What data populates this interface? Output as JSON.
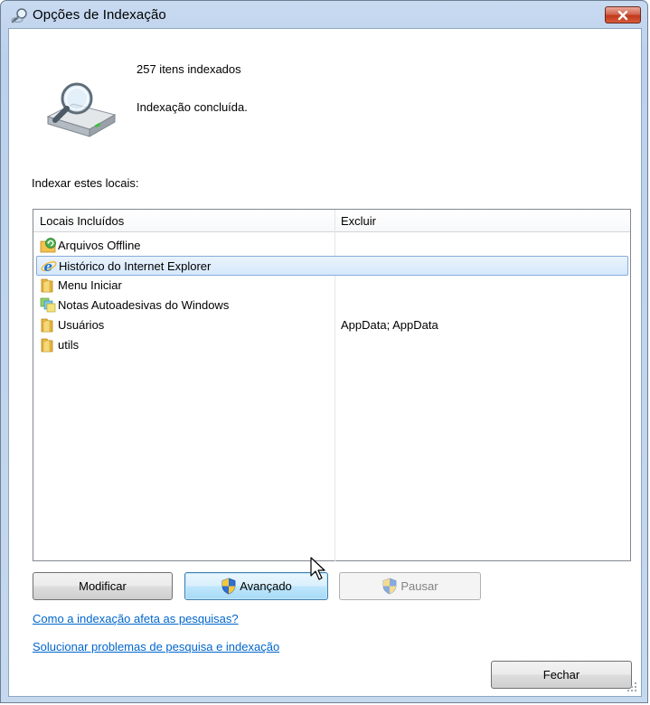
{
  "window": {
    "title": "Opções de Indexação",
    "close_label": "Fechar janela"
  },
  "summary": {
    "items_count": "257 itens indexados",
    "status": "Indexação concluída."
  },
  "locations": {
    "label": "Indexar estes locais:",
    "columns": [
      "Locais Incluídos",
      "Excluir"
    ],
    "rows": [
      {
        "name": "Arquivos Offline",
        "exclude": "",
        "icon": "offline-files-icon",
        "selected": false
      },
      {
        "name": "Histórico do Internet Explorer",
        "exclude": "",
        "icon": "internet-explorer-icon",
        "selected": true
      },
      {
        "name": "Menu Iniciar",
        "exclude": "",
        "icon": "folder-icon",
        "selected": false
      },
      {
        "name": "Notas Autoadesivas do Windows",
        "exclude": "",
        "icon": "sticky-notes-icon",
        "selected": false
      },
      {
        "name": "Usuários",
        "exclude": "AppData; AppData",
        "icon": "folder-icon",
        "selected": false
      },
      {
        "name": "utils",
        "exclude": "",
        "icon": "folder-icon",
        "selected": false
      }
    ]
  },
  "buttons": {
    "modify": "Modificar",
    "advanced": "Avançado",
    "pause": "Pausar",
    "close": "Fechar"
  },
  "links": {
    "how_indexing_affects": "Como a indexação afeta as pesquisas?",
    "troubleshoot": "Solucionar problemas de pesquisa e indexação"
  },
  "colors": {
    "frame": "#bcd1ec",
    "selection": "#d5e8fb",
    "link": "#0066cc",
    "close_button": "#c0391b"
  }
}
